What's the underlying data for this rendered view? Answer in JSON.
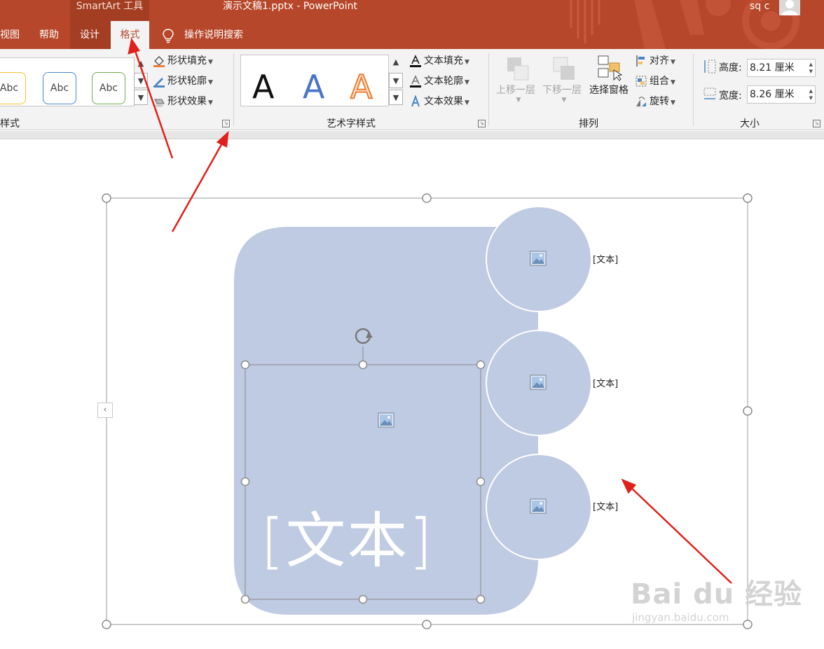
{
  "window": {
    "contextual_group": "SmartArt 工具",
    "document_title": "演示文稿1.pptx  -  PowerPoint",
    "user_name": "sq c"
  },
  "tabs": [
    {
      "label": "视图"
    },
    {
      "label": "帮助"
    },
    {
      "label": "设计"
    },
    {
      "label": "格式",
      "active": true
    }
  ],
  "tell_me": {
    "placeholder": "操作说明搜索"
  },
  "ribbon": {
    "shape_styles": {
      "group_label": "样式",
      "samples": [
        "Abc",
        "Abc",
        "Abc"
      ],
      "commands": [
        "形状填充",
        "形状轮廓",
        "形状效果"
      ]
    },
    "wordart_styles": {
      "group_label": "艺术字样式",
      "samples": [
        "A",
        "A",
        "A"
      ],
      "commands": [
        "文本填充",
        "文本轮廓",
        "文本效果"
      ]
    },
    "arrange": {
      "group_label": "排列",
      "bring_forward": "上移一层",
      "send_backward": "下移一层",
      "selection_pane": "选择窗格",
      "align": "对齐",
      "group": "组合",
      "rotate": "旋转"
    },
    "size": {
      "group_label": "大小",
      "height_label": "高度:",
      "height_value": "8.21 厘米",
      "width_label": "宽度:",
      "width_value": "8.26 厘米"
    }
  },
  "smartart": {
    "main_text": "[文本]",
    "node_texts": [
      "[文本]",
      "[文本]",
      "[文本]"
    ],
    "fill_color": "#bfcae3",
    "icons": [
      "picture-placeholder-icon",
      "picture-placeholder-icon",
      "picture-placeholder-icon",
      "picture-placeholder-icon"
    ]
  },
  "annotations": {
    "arrow_color": "#e0201b",
    "arrow_count": 3
  },
  "watermark": {
    "main": "Bai du 经验",
    "sub": "jingyan.baidu.com"
  },
  "colors": {
    "accent": "#b7472a",
    "ribbon": "#f3f3f3"
  }
}
